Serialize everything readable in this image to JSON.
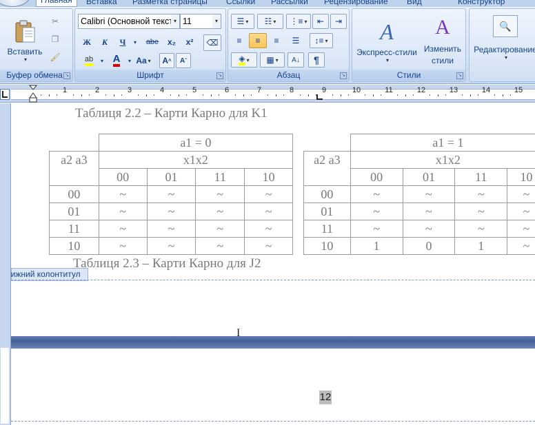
{
  "tabs": {
    "home": "Главная",
    "insert": "Вставка",
    "layout": "Разметка страницы",
    "refs": "Ссылки",
    "mail": "Рассылки",
    "review": "Рецензирование",
    "view": "Вид",
    "design": "Конструктор"
  },
  "clipboard": {
    "paste": "Вставить",
    "group": "Буфер обмена"
  },
  "font": {
    "name": "Calibri (Основной текст)",
    "size": "11",
    "bold": "Ж",
    "italic": "К",
    "underline": "Ч",
    "strike": "abe",
    "sub": "x₂",
    "sup": "x²",
    "text_color_letter": "A",
    "change_case": "Aa",
    "grow": "A",
    "shrink": "A",
    "group": "Шрифт"
  },
  "paragraph": {
    "group": "Абзац",
    "pilcrow": "¶"
  },
  "styles": {
    "express": "Экспресс-стили",
    "change": "Изменить стили",
    "group": "Стили"
  },
  "editing": {
    "label": "Редактирование"
  },
  "ruler": {
    "numbers": [
      "1",
      "2",
      "3",
      "4",
      "5",
      "6",
      "7",
      "8",
      "9",
      "10",
      "11",
      "12",
      "13",
      "14",
      "15"
    ]
  },
  "document": {
    "caption1": "Таблиця 2.2 – Карти Карно для K1",
    "caption2": "Таблиця 2.3 – Карти Карно для J2",
    "footer_label": "Нижний колонтитул",
    "page_number": "12",
    "table_left": {
      "title": "a1 = 0",
      "row_header": "a2 a3",
      "col_header": "x1x2",
      "cols": [
        "00",
        "01",
        "11",
        "10"
      ],
      "rows": [
        {
          "label": "00",
          "cells": [
            "~",
            "~",
            "~",
            "~"
          ]
        },
        {
          "label": "01",
          "cells": [
            "~",
            "~",
            "~",
            "~"
          ]
        },
        {
          "label": "11",
          "cells": [
            "~",
            "~",
            "~",
            "~"
          ]
        },
        {
          "label": "10",
          "cells": [
            "~",
            "~",
            "~",
            "~"
          ]
        }
      ]
    },
    "table_right": {
      "title": "a1 = 1",
      "row_header": "a2 a3",
      "col_header": "x1x2",
      "cols": [
        "00",
        "01",
        "11",
        "10"
      ],
      "rows": [
        {
          "label": "00",
          "cells": [
            "~",
            "~",
            "~",
            "~"
          ]
        },
        {
          "label": "01",
          "cells": [
            "~",
            "~",
            "~",
            "~"
          ]
        },
        {
          "label": "11",
          "cells": [
            "~",
            "~",
            "~",
            "~"
          ]
        },
        {
          "label": "10",
          "cells": [
            "1",
            "0",
            "1",
            "~"
          ]
        }
      ]
    }
  },
  "colors": {
    "ribbon": "#d5e3f4",
    "accent": "#15428b",
    "highlight": "#ffff00",
    "font_color": "#e00000"
  }
}
